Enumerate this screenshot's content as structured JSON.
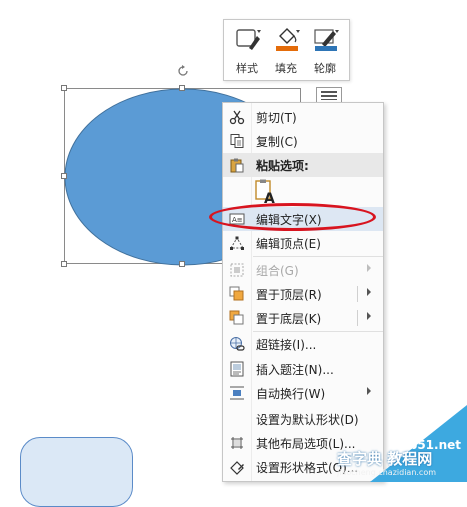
{
  "mini_toolbar": {
    "style_label": "样式",
    "fill_label": "填充",
    "outline_label": "轮廓",
    "fill_color": "#e46c0a",
    "outline_color": "#2e75b6"
  },
  "shapes": {
    "ellipse_fill": "#5b9bd5",
    "rounded_rect_fill": "#dbe8f6"
  },
  "context_menu": {
    "cut": "剪切(T)",
    "copy": "复制(C)",
    "paste_options_header": "粘贴选项:",
    "edit_text": "编辑文字(X)",
    "edit_points": "编辑顶点(E)",
    "group": "组合(G)",
    "bring_to_front": "置于顶层(R)",
    "send_to_back": "置于底层(K)",
    "hyperlink": "超链接(I)...",
    "insert_caption": "插入题注(N)...",
    "wrap_text": "自动换行(W)",
    "set_default": "设置为默认形状(D)",
    "more_layout": "其他布局选项(L)...",
    "format_shape": "设置形状格式(O)..."
  },
  "watermark": {
    "brand": "查字典 教程网",
    "url": "jb51.net",
    "small": "jiaocheng.chazidian.com"
  },
  "highlight_color": "#d8141f"
}
